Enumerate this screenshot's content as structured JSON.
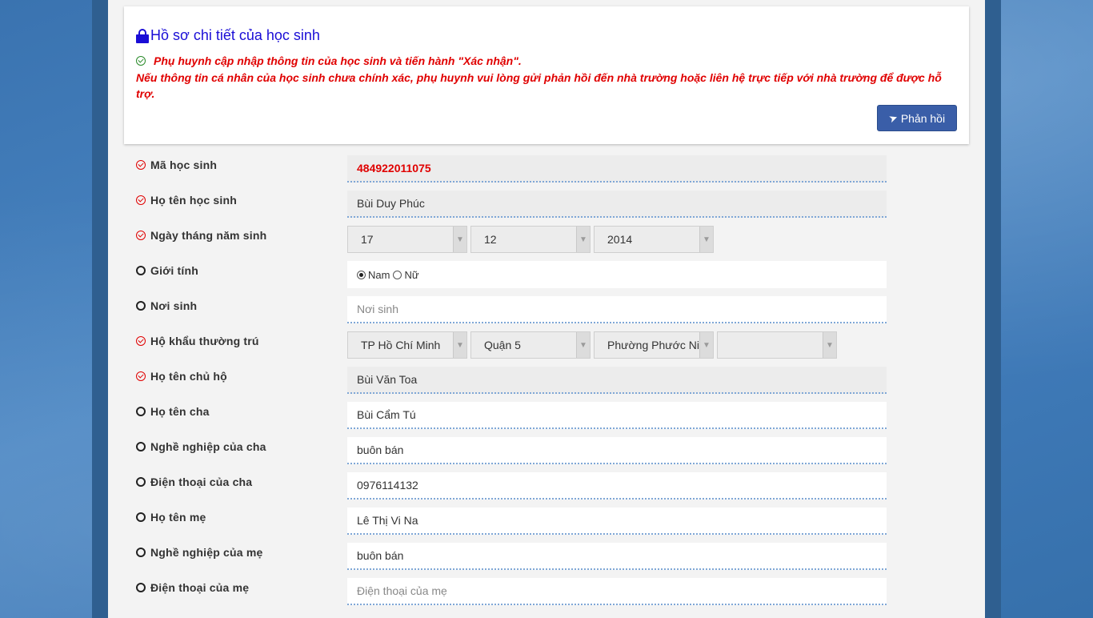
{
  "header": {
    "title": "Hồ sơ chi tiết của học sinh",
    "notice_line1": "Phụ huynh cập nhập thông tin của học sinh và tiến hành \"Xác nhận\".",
    "notice_line2": "Nếu thông tin cá nhân của học sinh chưa chính xác, phụ huynh vui lòng gửi phản hồi đến nhà trường hoặc liên hệ trực tiếp với nhà trường để được hỗ trợ.",
    "feedback_button": "Phản hồi"
  },
  "form": {
    "student_code": {
      "label": "Mã học sinh",
      "value": "484922011075"
    },
    "student_name": {
      "label": "Họ tên học sinh",
      "value": "Bùi Duy Phúc"
    },
    "dob": {
      "label": "Ngày tháng năm sinh",
      "day": "17",
      "month": "12",
      "year": "2014"
    },
    "gender": {
      "label": "Giới tính",
      "option_male": "Nam",
      "option_female": "Nữ",
      "selected": "Nam"
    },
    "birthplace": {
      "label": "Nơi sinh",
      "value": "",
      "placeholder": "Nơi sinh"
    },
    "residence": {
      "label": "Hộ khẩu thường trú",
      "city": "TP Hồ Chí Minh",
      "district": "Quận 5",
      "ward": "Phường Phước Ni",
      "extra": ""
    },
    "household_head": {
      "label": "Họ tên chủ hộ",
      "value": "Bùi Văn Toa"
    },
    "father_name": {
      "label": "Họ tên cha",
      "value": "Bùi Cẩm Tú"
    },
    "father_job": {
      "label": "Nghề nghiệp của cha",
      "value": "buôn bán"
    },
    "father_phone": {
      "label": "Điện thoại của cha",
      "value": "0976114132"
    },
    "mother_name": {
      "label": "Họ tên mẹ",
      "value": "Lê Thị Vi Na"
    },
    "mother_job": {
      "label": "Nghề nghiệp của mẹ",
      "value": "buôn bán"
    },
    "mother_phone": {
      "label": "Điện thoại của mẹ",
      "value": "",
      "placeholder": "Điện thoại của mẹ"
    }
  },
  "colors": {
    "title": "#1a0dd6",
    "notice": "#e00000",
    "button": "#3a5ea8",
    "required": "#e00000"
  }
}
